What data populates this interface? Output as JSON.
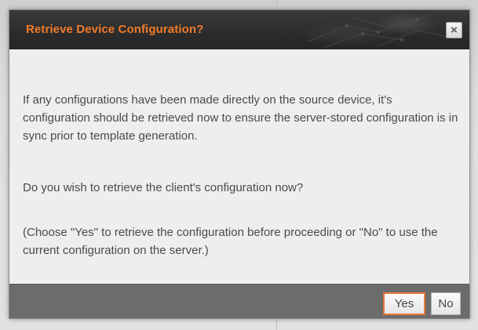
{
  "dialog": {
    "title": "Retrieve Device Configuration?",
    "close_icon": "×",
    "paragraphs": [
      "If any configurations have been made directly on the source device, it's configuration should be retrieved now to ensure the server-stored configuration is in sync prior to template generation.",
      "Do you wish to retrieve the client's configuration now?",
      "(Choose \"Yes\" to retrieve the configuration before proceeding or \"No\" to use the current configuration on the server.)"
    ],
    "buttons": {
      "yes_label": "Yes",
      "no_label": "No"
    }
  },
  "colors": {
    "title_text": "#f07b2b",
    "titlebar_bg": "#2b2b2b",
    "dialog_bg": "#eeeeee",
    "footer_bg": "#6c6c6c",
    "default_button_border": "#e8793a",
    "body_text": "#4a4a4a"
  },
  "icons": {
    "close": "close-icon"
  }
}
